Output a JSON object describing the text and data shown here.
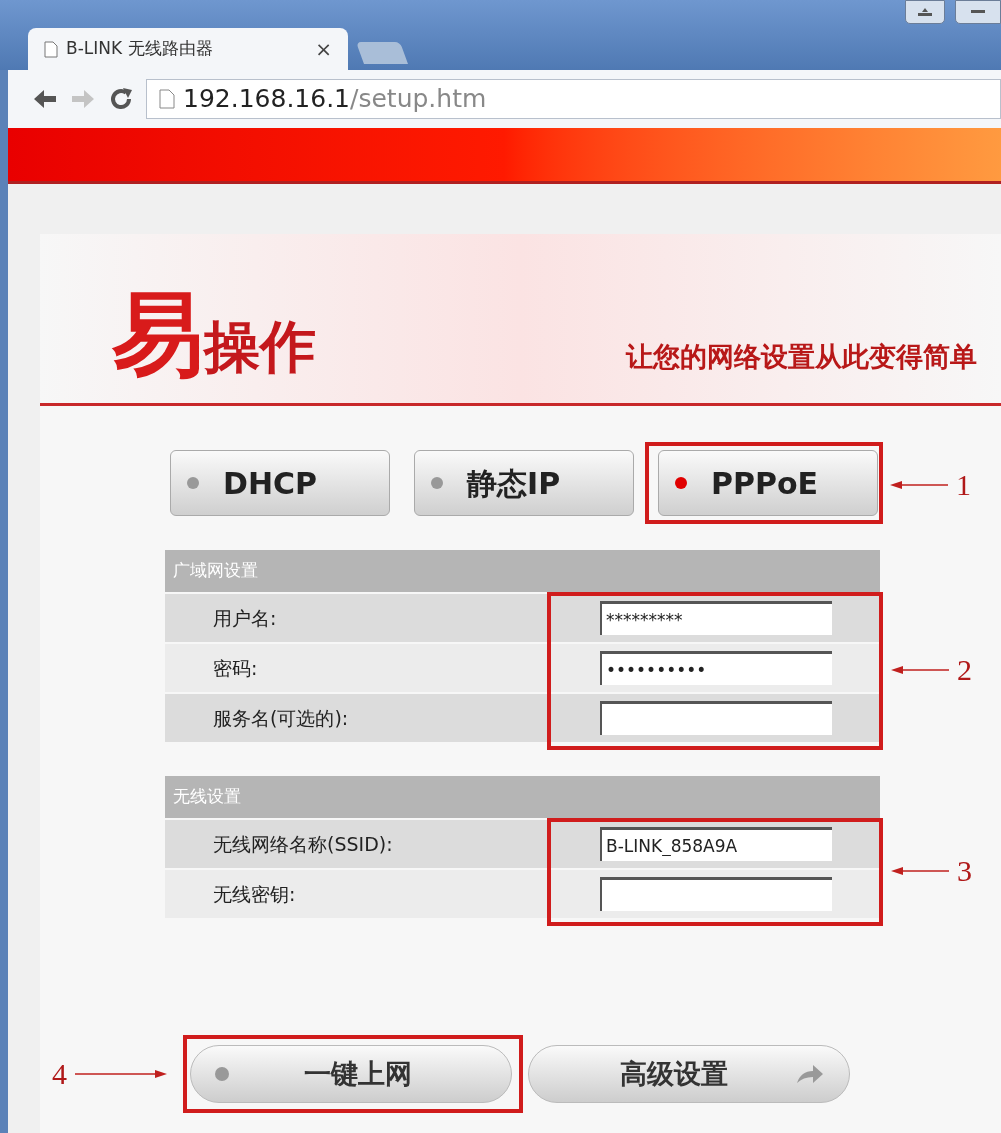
{
  "browser": {
    "tab": {
      "title": "B-LINK 无线路由器",
      "close": "×"
    },
    "address": {
      "host": "192.168.16.1",
      "path": "/setup.htm"
    }
  },
  "header": {
    "logo_big": "易",
    "logo_rest": "操作",
    "tagline": "让您的网络设置从此变得简单"
  },
  "modes": [
    {
      "label": "DHCP",
      "selected": false
    },
    {
      "label": "静态IP",
      "selected": false
    },
    {
      "label": "PPPoE",
      "selected": true
    }
  ],
  "sections": [
    {
      "title": "广域网设置",
      "fields": [
        {
          "label": "用户名:",
          "value": "*********"
        },
        {
          "label": "密码:",
          "value": "••••••••••"
        },
        {
          "label": "服务名(可选的):"
        }
      ]
    },
    {
      "title": "无线设置",
      "fields": [
        {
          "label": "无线网络名称(SSID):",
          "value": "B-LINK_858A9A"
        },
        {
          "label": "无线密钥:"
        }
      ]
    }
  ],
  "actions": [
    {
      "label": "一键上网",
      "kind": "connect"
    },
    {
      "label": "高级设置",
      "kind": "advanced"
    }
  ],
  "annotations": [
    {
      "number": "1"
    },
    {
      "number": "2"
    },
    {
      "number": "3"
    },
    {
      "number": "4"
    }
  ]
}
